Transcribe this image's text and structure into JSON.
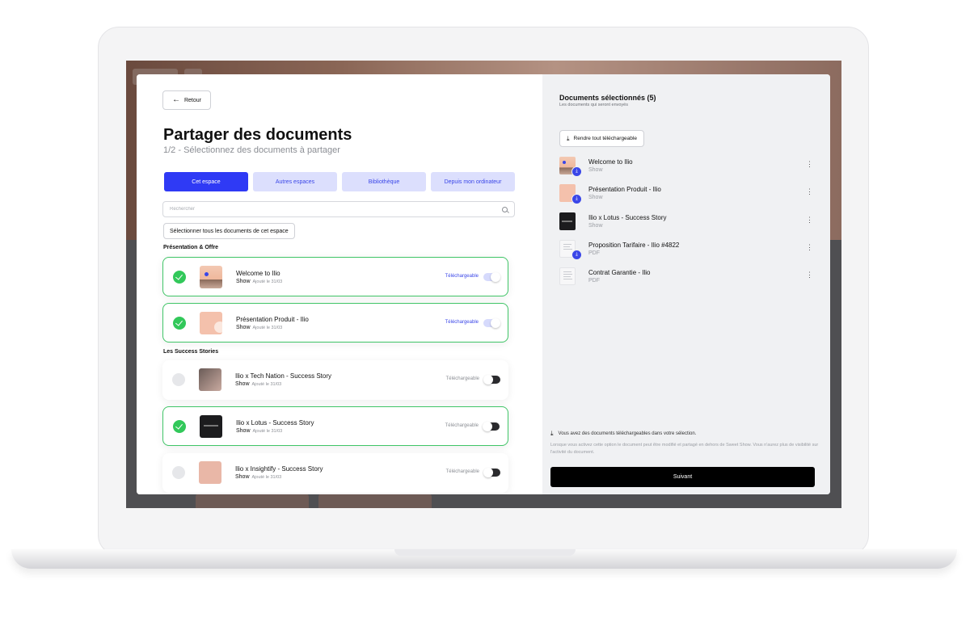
{
  "header": {
    "back_label": "Retour",
    "title": "Partager des documents",
    "subtitle": "1/2 - Sélectionnez des documents à partager"
  },
  "tabs": [
    {
      "label": "Cet espace",
      "active": true
    },
    {
      "label": "Autres espaces",
      "active": false
    },
    {
      "label": "Bibliothèque",
      "active": false
    },
    {
      "label": "Depuis mon ordinateur",
      "active": false
    }
  ],
  "search": {
    "placeholder": "Rechercher",
    "value": ""
  },
  "select_all_label": "Sélectionner tous les documents de cet espace",
  "sections": [
    {
      "title": "Présentation & Offre",
      "documents": [
        {
          "name": "Welcome to Ilio",
          "type": "Show",
          "date": "Ajouté le 31/03",
          "selected": true,
          "downloadable_label": "Téléchargeable",
          "downloadable": true,
          "thumb": "welcome"
        },
        {
          "name": "Présentation Produit - Ilio",
          "type": "Show",
          "date": "Ajouté le 31/03",
          "selected": true,
          "downloadable_label": "Téléchargeable",
          "downloadable": true,
          "thumb": "pres"
        }
      ]
    },
    {
      "title": "Les Success Stories",
      "documents": [
        {
          "name": "Ilio x Tech Nation - Success Story",
          "type": "Show",
          "date": "Ajouté le 31/03",
          "selected": false,
          "downloadable_label": "Téléchargeable",
          "downloadable": false,
          "thumb": "tech"
        },
        {
          "name": "Ilio x Lotus - Success Story",
          "type": "Show",
          "date": "Ajouté le 31/03",
          "selected": true,
          "downloadable_label": "Téléchargeable",
          "downloadable": false,
          "thumb": "lotus"
        },
        {
          "name": "Ilio x Insightify - Success Story",
          "type": "Show",
          "date": "Ajouté le 31/03",
          "selected": false,
          "downloadable_label": "Téléchargeable",
          "downloadable": false,
          "thumb": "insight"
        }
      ]
    }
  ],
  "selection_panel": {
    "title": "Documents sélectionnés (5)",
    "subtitle": "Les documents qui seront envoyés",
    "make_downloadable_label": "Rendre tout téléchargeable",
    "items": [
      {
        "name": "Welcome to Ilio",
        "type": "Show",
        "downloadable": true,
        "thumb": "welcome"
      },
      {
        "name": "Présentation Produit - Ilio",
        "type": "Show",
        "downloadable": true,
        "thumb": "pres"
      },
      {
        "name": "Ilio x Lotus - Success Story",
        "type": "Show",
        "downloadable": false,
        "thumb": "lotus"
      },
      {
        "name": "Proposition Tarifaire - Ilio #4822",
        "type": "PDF",
        "downloadable": true,
        "thumb": "doc"
      },
      {
        "name": "Contrat Garantie - Ilio",
        "type": "PDF",
        "downloadable": false,
        "thumb": "doc"
      }
    ],
    "notice": "Vous avez des documents téléchargeables dans votre sélection.",
    "notice_detail": "Lorsque vous activez cette option le document peut être modifié et partagé en dehors de Sweet Show. Vous n'aurez plus de visibilité sur l'activité du document.",
    "next_label": "Suivant"
  },
  "colors": {
    "accent": "#2f3af5",
    "accent_light": "#dcdffd",
    "success": "#32c85a",
    "panel_bg": "#f0f1f3"
  },
  "icons": {
    "back": "arrow-left-icon",
    "search": "search-icon",
    "download": "download-icon",
    "more": "more-vertical-icon",
    "check": "check-icon"
  }
}
